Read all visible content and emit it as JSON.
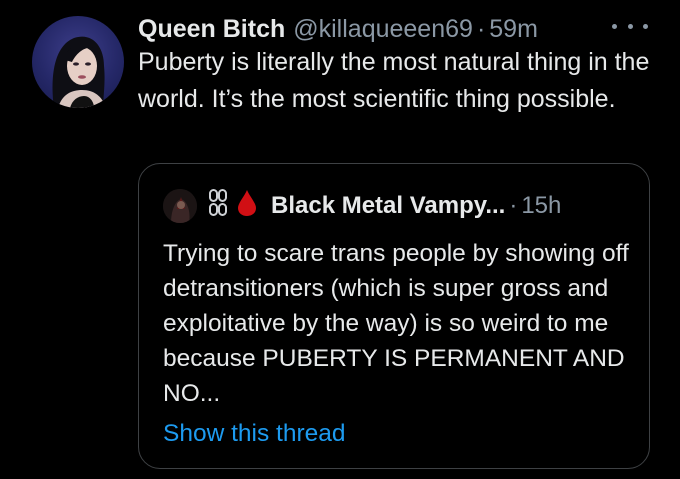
{
  "tweet": {
    "display_name": "Queen Bitch",
    "handle": "@killaqueeen69",
    "separator": "·",
    "time": "59m",
    "text": "Puberty is literally the most natural thing in the world. It’s the most scientific thing possible.",
    "more_icon": "ellipsis-icon"
  },
  "quoted_tweet": {
    "display_name": "Black Metal Vampy...",
    "separator": "·",
    "time": "15h",
    "name_emojis": [
      "chain-icon",
      "blood-drop-icon"
    ],
    "text": "Trying to scare trans people by showing off detransitioners (which is super gross and exploitative by the way) is so weird to me because PUBERTY IS PERMANENT AND NO...",
    "show_thread_label": "Show this thread"
  },
  "colors": {
    "background": "#000000",
    "primary_text": "#e7e9ea",
    "secondary_text": "#8b98a5",
    "link": "#1d9bf0",
    "border": "#3e4144",
    "blood": "#d10f14"
  }
}
